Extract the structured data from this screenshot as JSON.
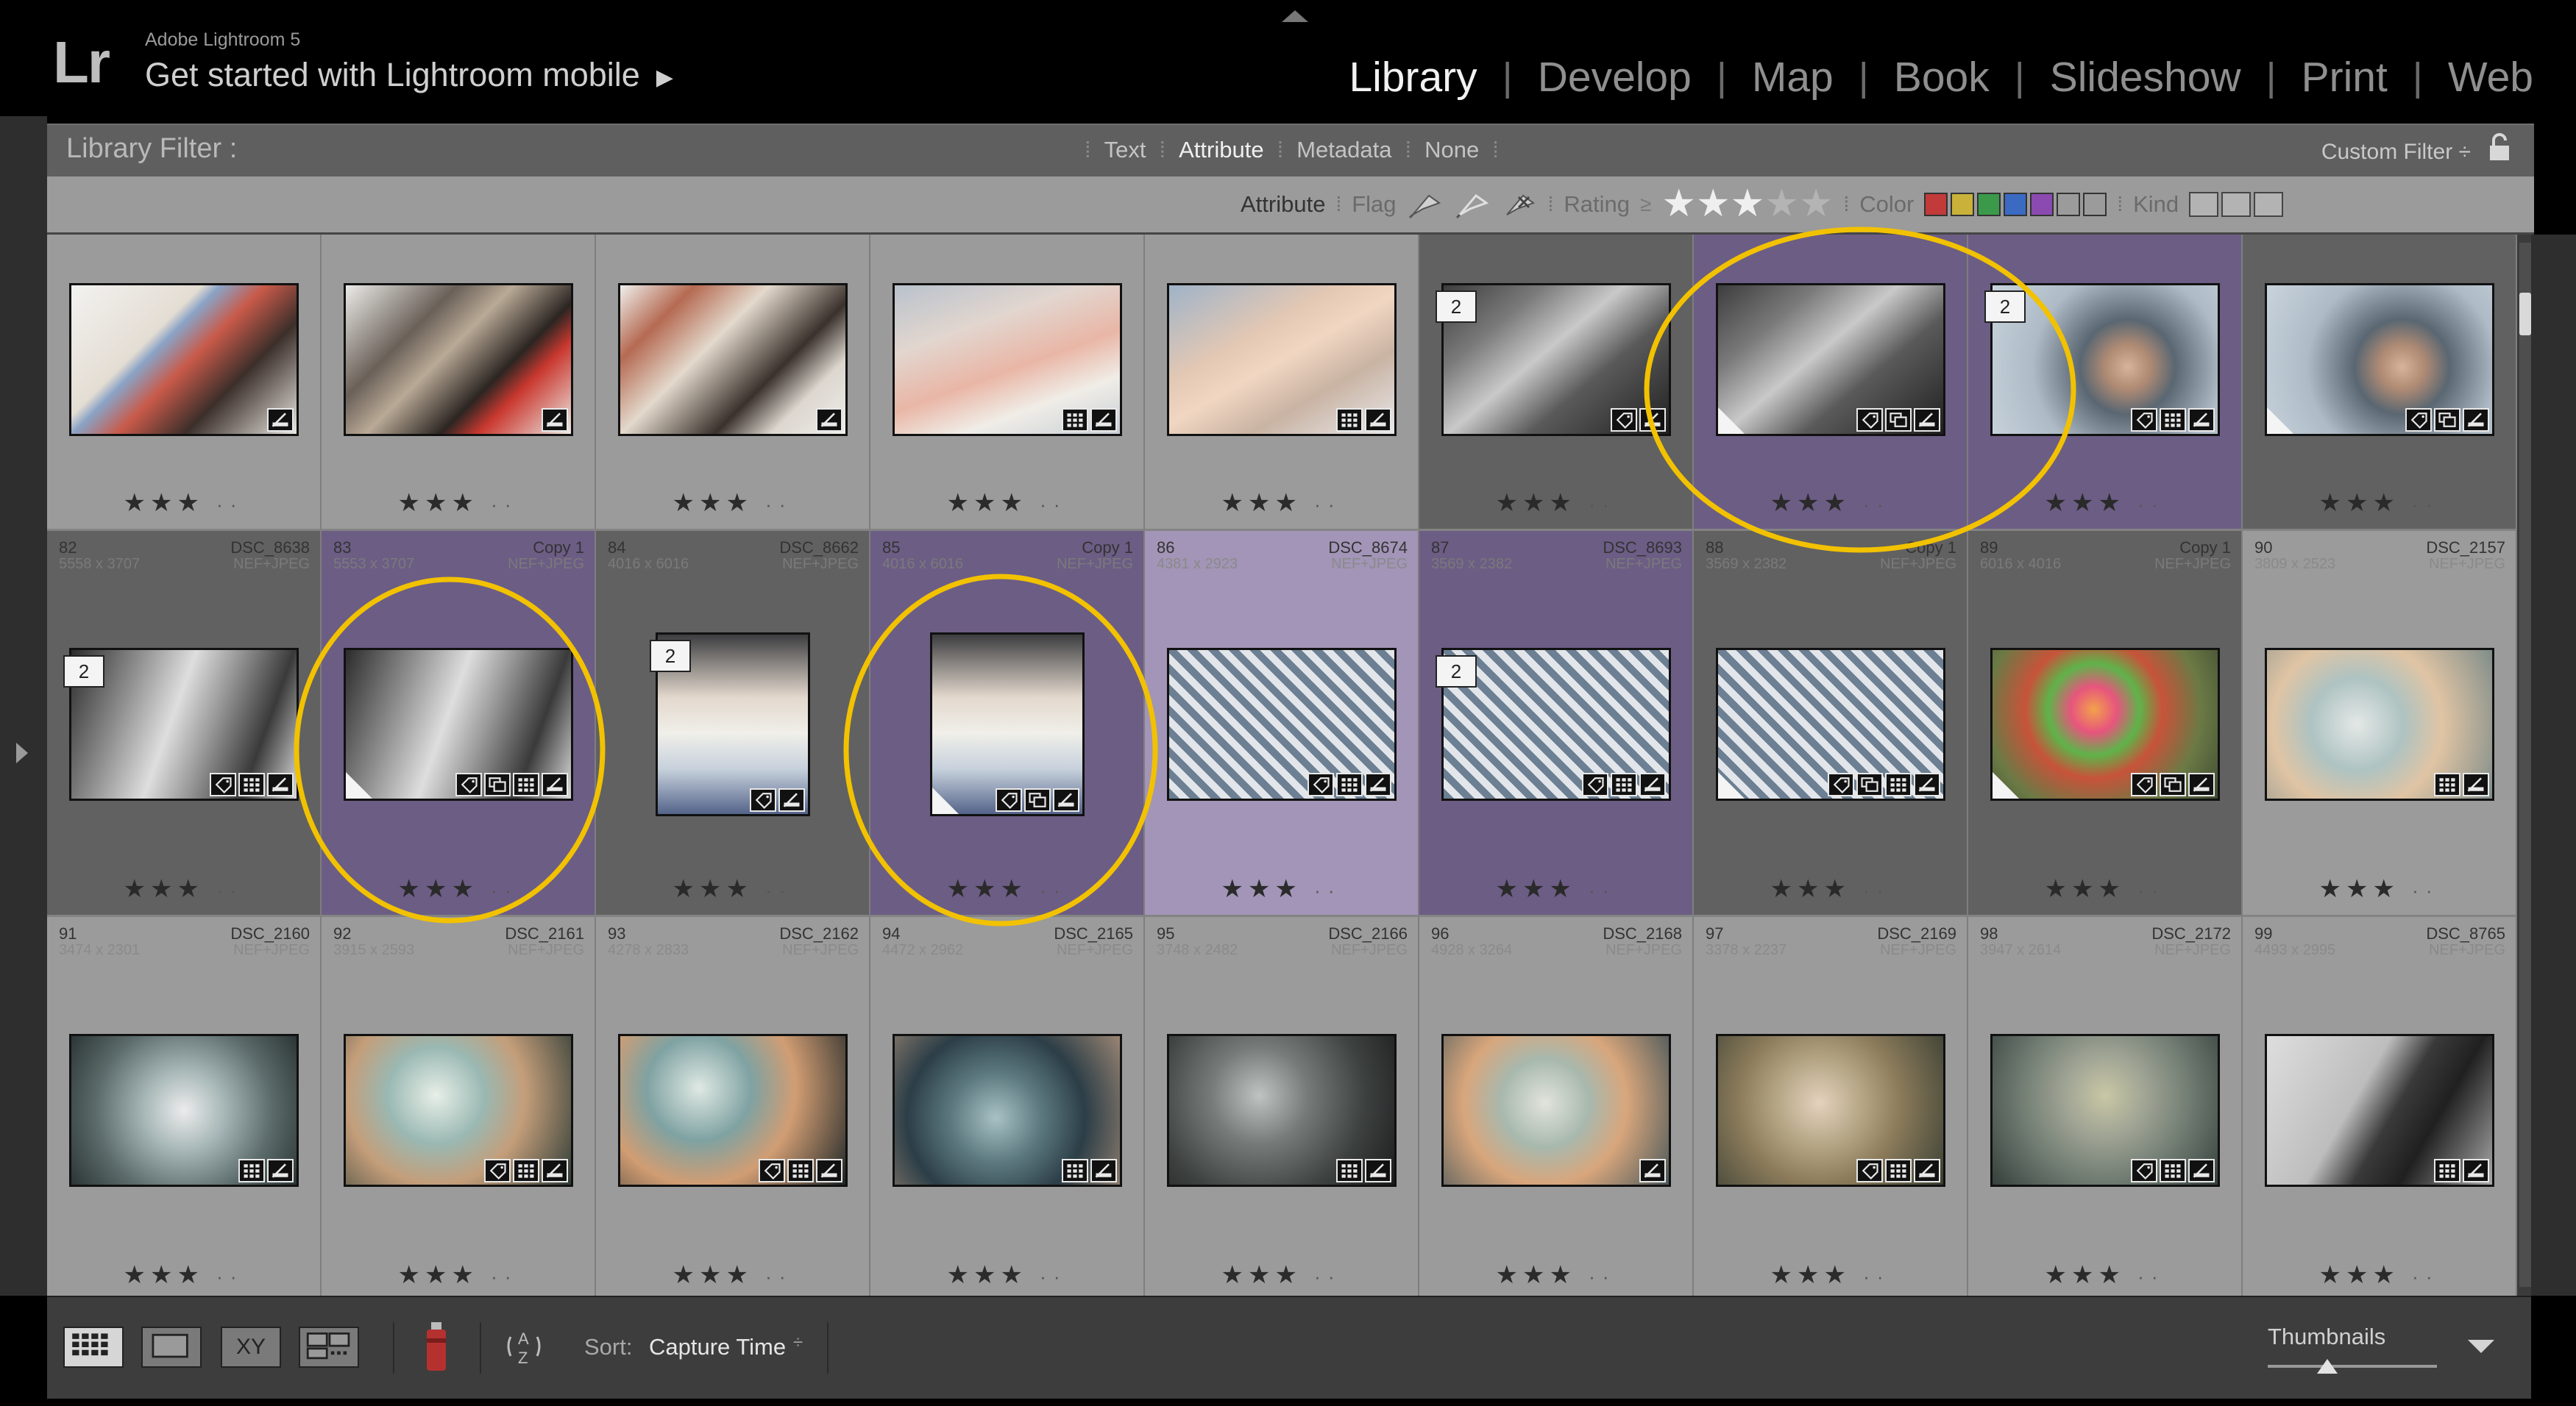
{
  "app": {
    "logo": "Lr",
    "name": "Adobe Lightroom 5",
    "identity_plate": "Get started with Lightroom mobile",
    "identity_arrow": "▶"
  },
  "modules": [
    {
      "label": "Library",
      "active": true
    },
    {
      "label": "Develop",
      "active": false
    },
    {
      "label": "Map",
      "active": false
    },
    {
      "label": "Book",
      "active": false
    },
    {
      "label": "Slideshow",
      "active": false
    },
    {
      "label": "Print",
      "active": false
    },
    {
      "label": "Web",
      "active": false
    }
  ],
  "filter": {
    "title": "Library Filter :",
    "tabs": [
      "Text",
      "Attribute",
      "Metadata",
      "None"
    ],
    "active_tab": "Attribute",
    "preset": "Custom Filter ÷",
    "attribute_label": "Attribute",
    "flag_label": "Flag",
    "rating_label": "Rating",
    "rating_op": "≥",
    "rating_stars": 3,
    "color_label": "Color",
    "kind_label": "Kind",
    "color_swatches": [
      "#c23a3a",
      "#c9b13a",
      "#3a9a4a",
      "#3a6ac2",
      "#8a4ab0",
      "#9b9b9b",
      "#9b9b9b"
    ]
  },
  "toolbar": {
    "compare_label": "XY",
    "sort_label": "Sort:",
    "sort_value": "Capture Time",
    "sort_chevron": "÷",
    "thumbnails_label": "Thumbnails",
    "thumbnail_size": 0.35
  },
  "grid": {
    "rows": [
      {
        "cells": [
          {
            "num": "",
            "file": "",
            "dims": "",
            "type": "",
            "state": "normal",
            "rating": 3,
            "stack": "",
            "flag_corner": false,
            "badges": [
              "edit"
            ],
            "tone": "disney1",
            "orient": "land"
          },
          {
            "num": "",
            "file": "",
            "dims": "",
            "type": "",
            "state": "normal",
            "rating": 3,
            "stack": "",
            "flag_corner": false,
            "badges": [
              "edit"
            ],
            "tone": "disney2",
            "orient": "land"
          },
          {
            "num": "",
            "file": "",
            "dims": "",
            "type": "",
            "state": "normal",
            "rating": 3,
            "stack": "",
            "flag_corner": false,
            "badges": [
              "edit"
            ],
            "tone": "disney3",
            "orient": "land"
          },
          {
            "num": "",
            "file": "",
            "dims": "",
            "type": "",
            "state": "normal",
            "rating": 3,
            "stack": "",
            "flag_corner": false,
            "badges": [
              "meta",
              "edit"
            ],
            "tone": "sleep",
            "orient": "land"
          },
          {
            "num": "",
            "file": "",
            "dims": "",
            "type": "",
            "state": "normal",
            "rating": 3,
            "stack": "",
            "flag_corner": false,
            "badges": [
              "meta",
              "edit"
            ],
            "tone": "yawn",
            "orient": "land"
          },
          {
            "num": "",
            "file": "",
            "dims": "",
            "type": "",
            "state": "dark",
            "rating": 3,
            "stack": "2",
            "flag_corner": false,
            "badges": [
              "key",
              "edit"
            ],
            "tone": "bwsleep",
            "orient": "land"
          },
          {
            "num": "",
            "file": "",
            "dims": "",
            "type": "",
            "state": "purple",
            "rating": 3,
            "stack": "",
            "flag_corner": true,
            "badges": [
              "key",
              "copy",
              "edit"
            ],
            "tone": "bwsleep",
            "orient": "land"
          },
          {
            "num": "",
            "file": "",
            "dims": "",
            "type": "",
            "state": "purple",
            "rating": 3,
            "stack": "2",
            "flag_corner": false,
            "badges": [
              "key",
              "meta",
              "edit"
            ],
            "tone": "kidface",
            "orient": "land"
          },
          {
            "num": "",
            "file": "",
            "dims": "",
            "type": "",
            "state": "dark",
            "rating": 3,
            "stack": "",
            "flag_corner": true,
            "badges": [
              "key",
              "copy",
              "edit"
            ],
            "tone": "kidface",
            "orient": "land"
          }
        ]
      },
      {
        "cells": [
          {
            "num": "82",
            "file": "DSC_8638",
            "dims": "5558 x 3707",
            "type": "NEF+JPEG",
            "state": "dark",
            "rating": 3,
            "stack": "2",
            "flag_corner": false,
            "badges": [
              "key",
              "meta",
              "edit"
            ],
            "tone": "bwlaugh",
            "orient": "land"
          },
          {
            "num": "83",
            "file": "Copy 1",
            "dims": "5553 x 3707",
            "type": "NEF+JPEG",
            "state": "purple",
            "rating": 3,
            "stack": "",
            "flag_corner": true,
            "badges": [
              "key",
              "copy",
              "meta",
              "edit"
            ],
            "tone": "bwlaugh",
            "orient": "land"
          },
          {
            "num": "84",
            "file": "DSC_8662",
            "dims": "4016 x 6016",
            "type": "NEF+JPEG",
            "state": "dark",
            "rating": 3,
            "stack": "2",
            "flag_corner": false,
            "badges": [
              "key",
              "edit"
            ],
            "tone": "towel",
            "orient": "port"
          },
          {
            "num": "85",
            "file": "Copy 1",
            "dims": "4016 x 6016",
            "type": "NEF+JPEG",
            "state": "purple",
            "rating": 3,
            "stack": "",
            "flag_corner": true,
            "badges": [
              "key",
              "copy",
              "edit"
            ],
            "tone": "towel",
            "orient": "port"
          },
          {
            "num": "86",
            "file": "DSC_8674",
            "dims": "4381 x 2923",
            "type": "NEF+JPEG",
            "state": "lilac",
            "rating": 3,
            "stack": "",
            "flag_corner": false,
            "badges": [
              "key",
              "meta",
              "edit"
            ],
            "tone": "chevron",
            "orient": "land"
          },
          {
            "num": "87",
            "file": "DSC_8693",
            "dims": "3569 x 2382",
            "type": "NEF+JPEG",
            "state": "purple",
            "rating": 3,
            "stack": "2",
            "flag_corner": false,
            "badges": [
              "key",
              "meta",
              "edit"
            ],
            "tone": "chevron",
            "orient": "land"
          },
          {
            "num": "88",
            "file": "Copy 1",
            "dims": "3569 x 2382",
            "type": "NEF+JPEG",
            "state": "dark",
            "rating": 3,
            "stack": "",
            "flag_corner": true,
            "badges": [
              "key",
              "copy",
              "meta",
              "edit"
            ],
            "tone": "chevron",
            "orient": "land"
          },
          {
            "num": "89",
            "file": "Copy 1",
            "dims": "6016 x 4016",
            "type": "NEF+JPEG",
            "state": "dark",
            "rating": 3,
            "stack": "",
            "flag_corner": true,
            "badges": [
              "key",
              "copy",
              "edit"
            ],
            "tone": "toy",
            "orient": "land"
          },
          {
            "num": "90",
            "file": "DSC_2157",
            "dims": "3809 x 2523",
            "type": "NEF+JPEG",
            "state": "normal",
            "rating": 3,
            "stack": "",
            "flag_corner": false,
            "badges": [
              "meta",
              "edit"
            ],
            "tone": "frost1",
            "orient": "land"
          }
        ]
      },
      {
        "cells": [
          {
            "num": "91",
            "file": "DSC_2160",
            "dims": "3474 x 2301",
            "type": "NEF+JPEG",
            "state": "normal",
            "rating": 3,
            "stack": "",
            "flag_corner": false,
            "badges": [
              "meta",
              "edit"
            ],
            "tone": "frost2",
            "orient": "land"
          },
          {
            "num": "92",
            "file": "DSC_2161",
            "dims": "3915 x 2593",
            "type": "NEF+JPEG",
            "state": "normal",
            "rating": 3,
            "stack": "",
            "flag_corner": false,
            "badges": [
              "key",
              "meta",
              "edit"
            ],
            "tone": "frost3",
            "orient": "land"
          },
          {
            "num": "93",
            "file": "DSC_2162",
            "dims": "4278 x 2833",
            "type": "NEF+JPEG",
            "state": "normal",
            "rating": 3,
            "stack": "",
            "flag_corner": false,
            "badges": [
              "key",
              "meta",
              "edit"
            ],
            "tone": "frost4",
            "orient": "land"
          },
          {
            "num": "94",
            "file": "DSC_2165",
            "dims": "4472 x 2962",
            "type": "NEF+JPEG",
            "state": "normal",
            "rating": 3,
            "stack": "",
            "flag_corner": false,
            "badges": [
              "meta",
              "edit"
            ],
            "tone": "frost5",
            "orient": "land"
          },
          {
            "num": "95",
            "file": "DSC_2166",
            "dims": "3748 x 2482",
            "type": "NEF+JPEG",
            "state": "normal",
            "rating": 3,
            "stack": "",
            "flag_corner": false,
            "badges": [
              "meta",
              "edit"
            ],
            "tone": "frost6",
            "orient": "land"
          },
          {
            "num": "96",
            "file": "DSC_2168",
            "dims": "4928 x 3264",
            "type": "NEF+JPEG",
            "state": "normal",
            "rating": 3,
            "stack": "",
            "flag_corner": false,
            "badges": [
              "edit"
            ],
            "tone": "frost7",
            "orient": "land"
          },
          {
            "num": "97",
            "file": "DSC_2169",
            "dims": "3378 x 2237",
            "type": "NEF+JPEG",
            "state": "normal",
            "rating": 3,
            "stack": "",
            "flag_corner": false,
            "badges": [
              "key",
              "meta",
              "edit"
            ],
            "tone": "frost8",
            "orient": "land"
          },
          {
            "num": "98",
            "file": "DSC_2172",
            "dims": "3947 x 2614",
            "type": "NEF+JPEG",
            "state": "normal",
            "rating": 3,
            "stack": "",
            "flag_corner": false,
            "badges": [
              "key",
              "meta",
              "edit"
            ],
            "tone": "frost9",
            "orient": "land"
          },
          {
            "num": "99",
            "file": "DSC_8765",
            "dims": "4493 x 2995",
            "type": "NEF+JPEG",
            "state": "normal",
            "rating": 3,
            "stack": "",
            "flag_corner": false,
            "badges": [
              "meta",
              "edit"
            ],
            "tone": "bwboy",
            "orient": "land"
          }
        ]
      }
    ]
  },
  "annotation_color": "#f2c200"
}
